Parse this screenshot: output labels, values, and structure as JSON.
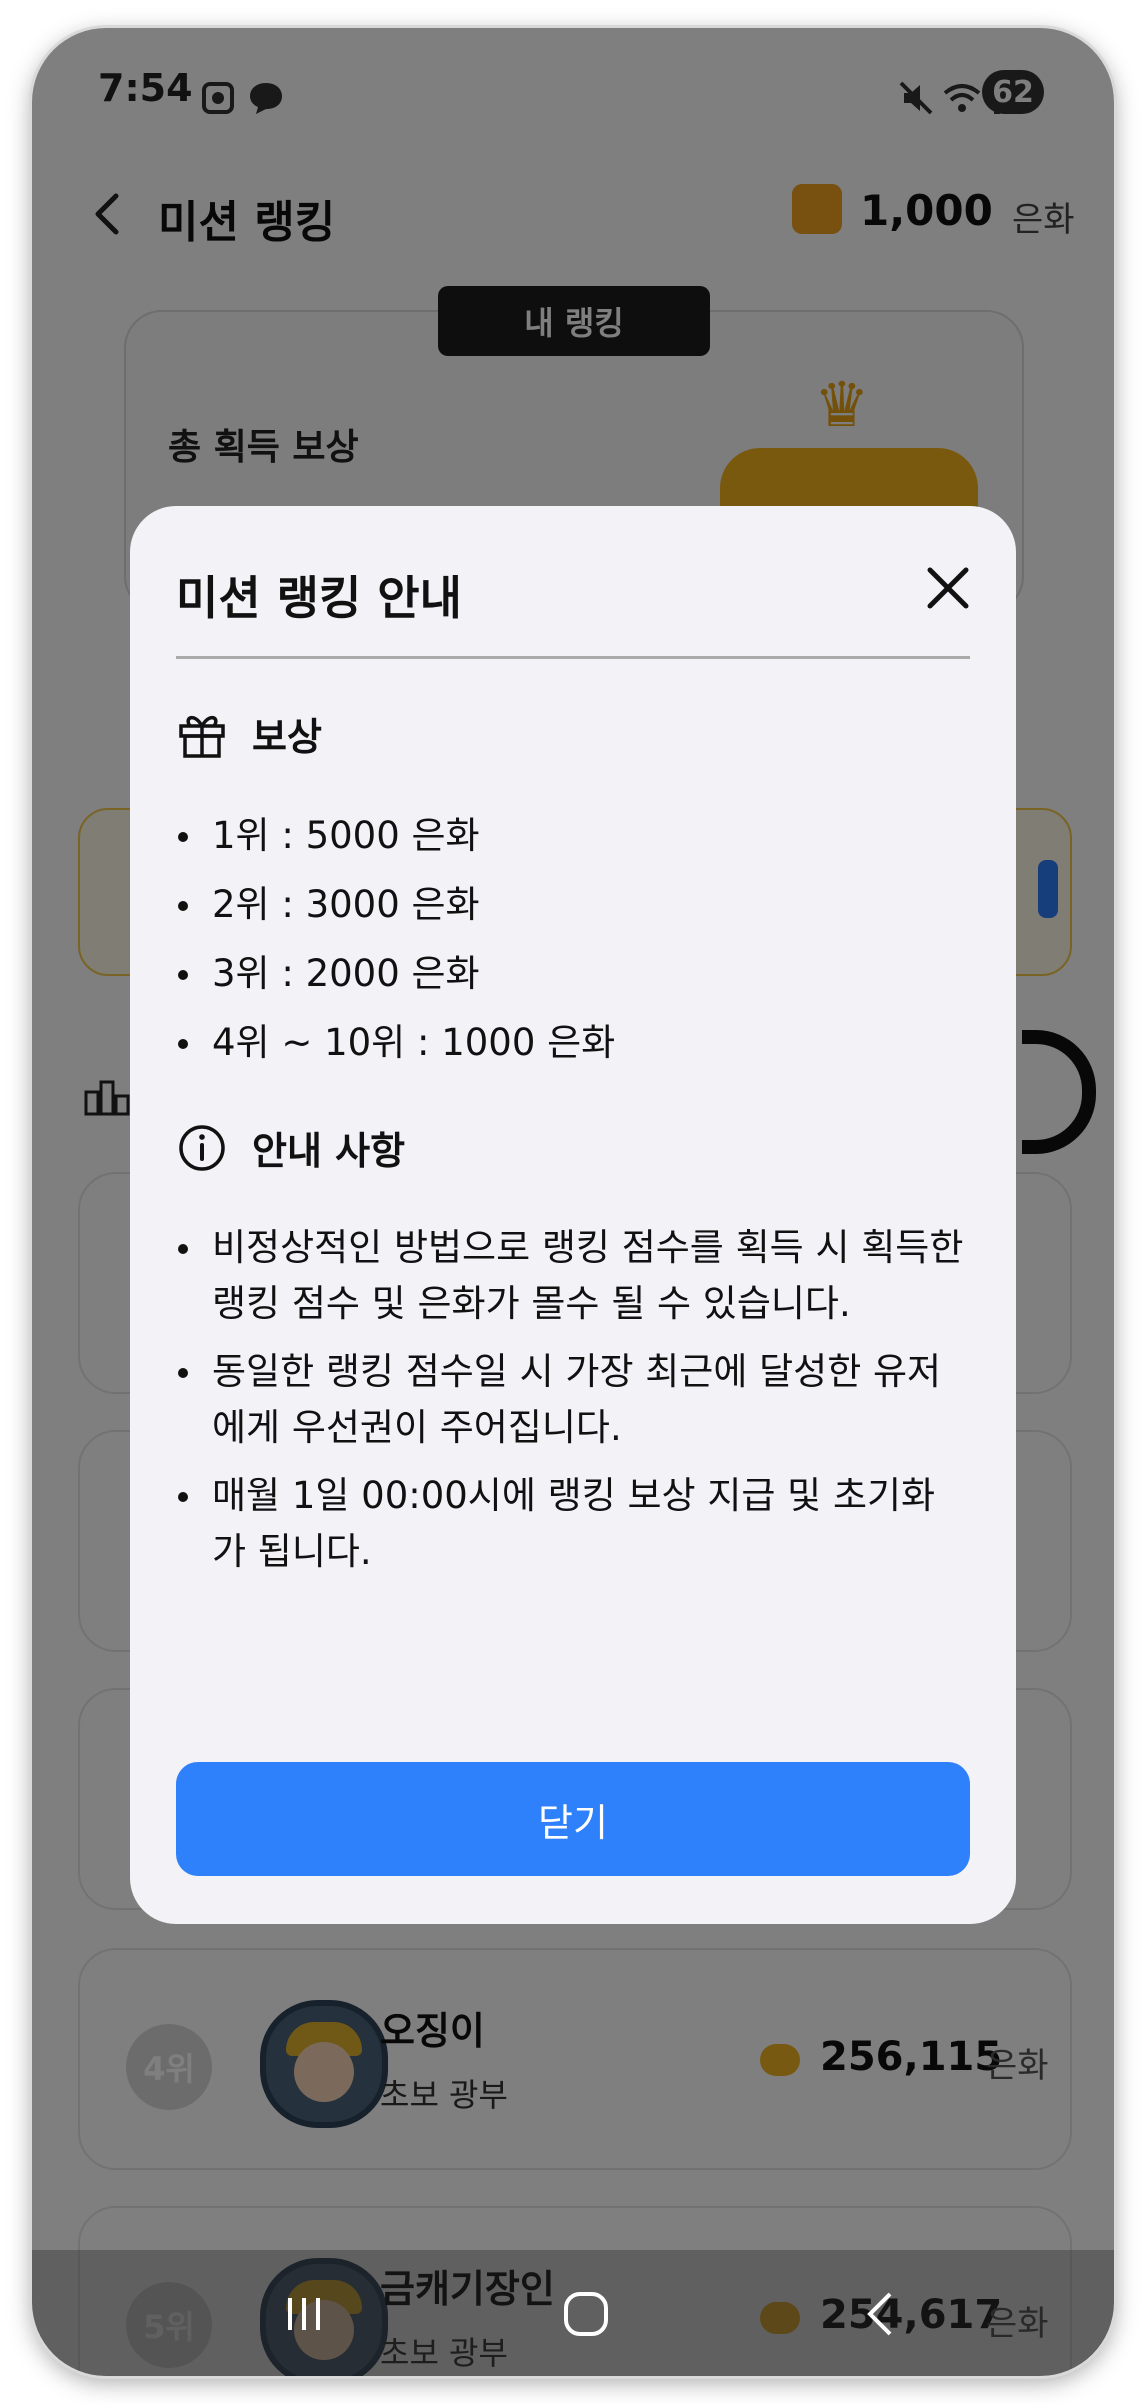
{
  "status_bar": {
    "time": "7:54",
    "battery": "62",
    "icons": [
      "screenshot-icon",
      "chat-icon",
      "mute-icon",
      "wifi-icon",
      "signal-icon"
    ]
  },
  "header": {
    "title": "미션 랭킹",
    "coin_amount": "1,000",
    "coin_unit": "은화"
  },
  "my_ranking": {
    "tab_label": "내 랭킹",
    "total_reward_label": "총 획득 보상"
  },
  "ranking_list": [
    {
      "rank": "4위",
      "name": "오징이",
      "title": "초보 광부",
      "score": "256,115",
      "unit": "은화"
    },
    {
      "rank": "5위",
      "name": "금캐기장인",
      "title": "초보 광부",
      "score": "254,617",
      "unit": "은화"
    }
  ],
  "modal": {
    "title": "미션 랭킹 안내",
    "rewards_heading": "보상",
    "rewards": [
      "1위 : 5000 은화",
      "2위 : 3000 은화",
      "3위 : 2000 은화",
      "4위 ~ 10위 : 1000 은화"
    ],
    "notices_heading": "안내 사항",
    "notices": [
      "비정상적인 방법으로 랭킹 점수를 획득 시 획득한 랭킹 점수 및 은화가 몰수 될 수 있습니다.",
      "동일한 랭킹 점수일 시 가장 최근에 달성한 유저에게 우선권이 주어집니다.",
      "매월 1일 00:00시에 랭킹 보상 지급 및 초기화가 됩니다."
    ],
    "close_label": "닫기"
  },
  "colors": {
    "primary": "#2f80fb",
    "coin": "#f0a020",
    "modal_bg": "#f2f2f7"
  }
}
